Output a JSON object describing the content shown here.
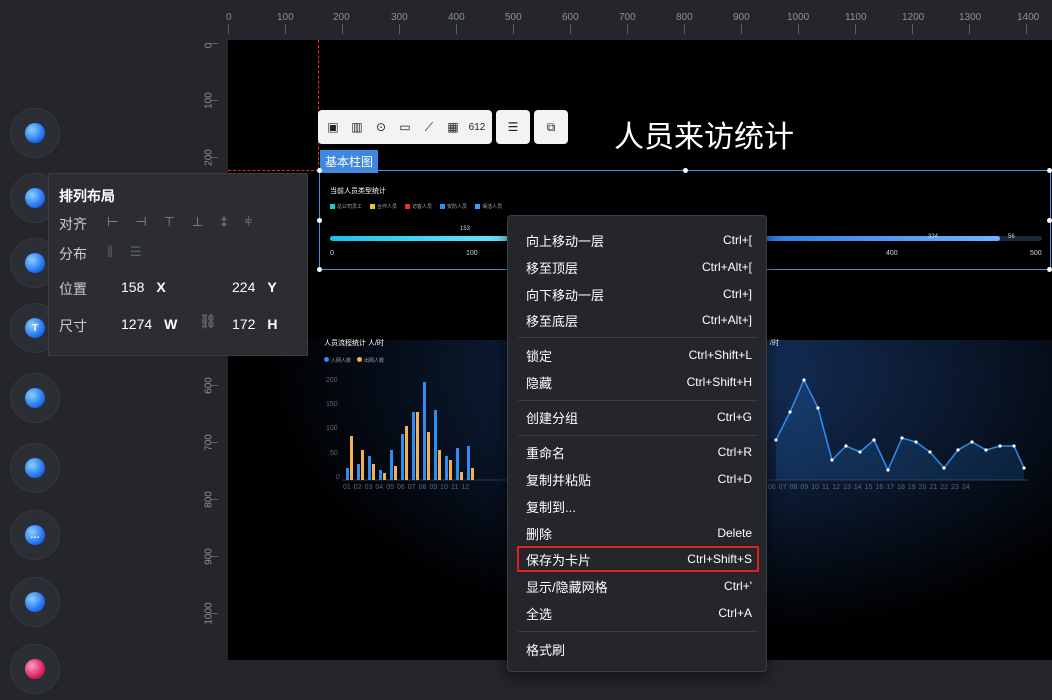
{
  "ruler": {
    "top_ticks": [
      "0",
      "100",
      "200",
      "300",
      "400",
      "500",
      "600",
      "700",
      "800",
      "900",
      "1000",
      "1100",
      "1200",
      "1300",
      "1400"
    ],
    "left_ticks": [
      "0",
      "100",
      "200",
      "600",
      "700",
      "800",
      "900",
      "1000"
    ]
  },
  "dock": {
    "items": [
      {
        "icon": "chart-icon"
      },
      {
        "icon": "media-icon"
      },
      {
        "icon": "map-icon"
      },
      {
        "icon": "text-icon",
        "glyph": "T"
      },
      {
        "icon": "gear-icon"
      },
      {
        "icon": "globe-icon"
      },
      {
        "icon": "more-icon",
        "glyph": "…"
      },
      {
        "icon": "navigation-icon"
      },
      {
        "icon": "record-icon"
      }
    ]
  },
  "widget": {
    "title": "人员来访统计",
    "tag": "基本柱图",
    "toolbar": {
      "icons": [
        "image-icon",
        "bar-chart-icon",
        "eye-target-icon",
        "comment-icon",
        "line-chart-icon",
        "multi-bar-icon",
        "number-icon",
        "database-icon",
        "link-icon"
      ],
      "number_text": "612"
    }
  },
  "chart1": {
    "title": "当前人员类型统计",
    "legend": [
      "总公司员工",
      "合作人员",
      "访客人员",
      "安防人员",
      "保洁人员"
    ],
    "legend_colors": [
      "#1fc7d8",
      "#f3c12e",
      "#e0342b",
      "#2f8cf0",
      "#3aa0ff"
    ],
    "value_left": "153",
    "value_mid": "324",
    "value_right": "56",
    "axis": [
      "0",
      "100",
      "400",
      "500"
    ]
  },
  "chart2": {
    "title": "人员流程统计 人/时",
    "legend": [
      "入网人数",
      "出网人数"
    ],
    "legend_colors": [
      "#2f8cf0",
      "#f5b056"
    ],
    "y_ticks": [
      "200",
      "150",
      "100",
      "50",
      "0"
    ],
    "x_labels": [
      "01",
      "02",
      "03",
      "04",
      "05",
      "06",
      "07",
      "08",
      "09",
      "10",
      "11",
      "12"
    ]
  },
  "chart3": {
    "title": "/时",
    "x_labels": [
      "06",
      "07",
      "08",
      "09",
      "10",
      "11",
      "12",
      "13",
      "14",
      "15",
      "16",
      "17",
      "18",
      "19",
      "20",
      "21",
      "22",
      "23",
      "24"
    ]
  },
  "props": {
    "title": "排列布局",
    "align_label": "对齐",
    "distribute_label": "分布",
    "position_label": "位置",
    "size_label": "尺寸",
    "x_value": "158",
    "x_unit": "X",
    "y_value": "224",
    "y_unit": "Y",
    "w_value": "1274",
    "w_unit": "W",
    "h_value": "172",
    "h_unit": "H"
  },
  "context_menu": {
    "items": [
      {
        "label": "向上移动一层",
        "shortcut": "Ctrl+["
      },
      {
        "label": "移至顶层",
        "shortcut": "Ctrl+Alt+["
      },
      {
        "label": "向下移动一层",
        "shortcut": "Ctrl+]"
      },
      {
        "label": "移至底层",
        "shortcut": "Ctrl+Alt+]"
      },
      {
        "label": "锁定",
        "shortcut": "Ctrl+Shift+L"
      },
      {
        "label": "隐藏",
        "shortcut": "Ctrl+Shift+H"
      },
      {
        "label": "创建分组",
        "shortcut": "Ctrl+G"
      },
      {
        "label": "重命名",
        "shortcut": "Ctrl+R"
      },
      {
        "label": "复制并粘贴",
        "shortcut": "Ctrl+D"
      },
      {
        "label": "复制到...",
        "shortcut": ""
      },
      {
        "label": "删除",
        "shortcut": "Delete"
      },
      {
        "label": "保存为卡片",
        "shortcut": "Ctrl+Shift+S",
        "highlighted": true
      },
      {
        "label": "显示/隐藏网格",
        "shortcut": "Ctrl+'"
      },
      {
        "label": "全选",
        "shortcut": "Ctrl+A"
      },
      {
        "label": "格式刷",
        "shortcut": ""
      }
    ]
  }
}
